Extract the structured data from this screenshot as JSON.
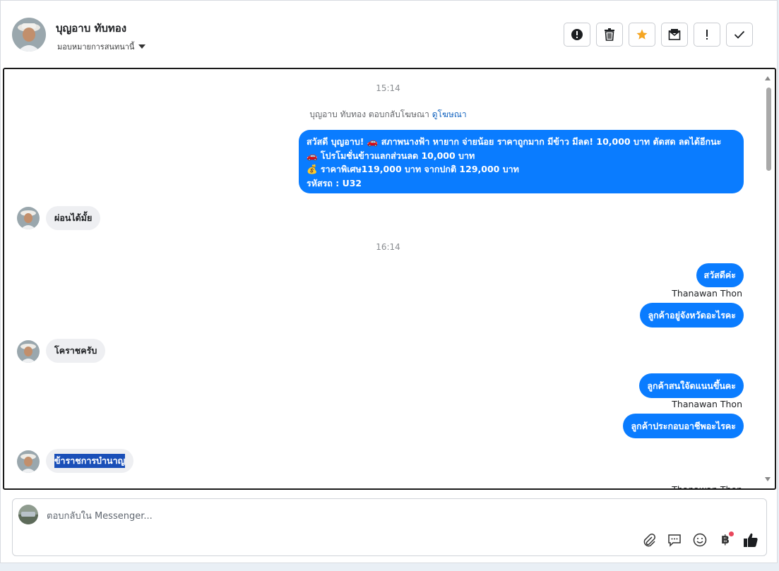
{
  "header": {
    "contact_name": "บุญอาบ ทับทอง",
    "assign_label": "มอบหมายการสนทนานี้",
    "actions": [
      {
        "name": "spam-button",
        "icon": "alert-circle-icon"
      },
      {
        "name": "delete-button",
        "icon": "trash-icon"
      },
      {
        "name": "star-button",
        "icon": "star-icon"
      },
      {
        "name": "mark-unread-button",
        "icon": "envelope-icon"
      },
      {
        "name": "follow-up-button",
        "icon": "exclamation-icon"
      },
      {
        "name": "done-button",
        "icon": "check-icon"
      }
    ]
  },
  "chat": {
    "timestamp_1": "15:14",
    "ad_reply_text": "บุญอาบ ทับทอง ตอบกลับโฆษณา",
    "ad_reply_link": "ดูโฆษณา",
    "outgoing_ad": {
      "line1": "สวัสดี บุญอาบ! 🚗 สภาพนางฟ้า หายาก จ่ายน้อย ราคาถูกมาก มีข้าว มีลด!  10,000 บาท  ตัดสด ลดได้อีกนะ",
      "line2": "🚗 โปรโมชั่นข้าวแลกส่วนลด 10,000 บาท",
      "line3": "💰 ราคาพิเศษ119,000 บาท จากปกติ 129,000 บาท",
      "line4": "รหัสรถ : U32"
    },
    "incoming_1": "ผ่อนได้มั้ย",
    "timestamp_2": "16:14",
    "outgoing_1": "สวัสดีค่ะ",
    "sender_1": "Thanawan Thon",
    "outgoing_2": "ลูกค้าอยู่จังหวัดอะไรคะ",
    "incoming_2": "โคราชครับ",
    "outgoing_3": "ลูกค้าสนใจัดแนนขึ้นคะ",
    "sender_2": "Thanawan Thon",
    "outgoing_4": "ลูกค้าประกอบอาชีพอะไรคะ",
    "incoming_3": "ข้าราชการบำนาญ",
    "sender_3": "Thanawan Thon"
  },
  "composer": {
    "placeholder": "ตอบกลับใน Messenger...",
    "value": "",
    "tools": [
      "paperclip-icon",
      "reply-bubble-icon",
      "emoji-icon",
      "baht-icon",
      "thumbs-up-icon"
    ],
    "baht_glyph": "฿"
  },
  "colors": {
    "outgoing_bubble": "#0a7cff",
    "incoming_bubble": "#eeeff2",
    "star": "#f5a623",
    "notification_dot": "#e8475c"
  }
}
